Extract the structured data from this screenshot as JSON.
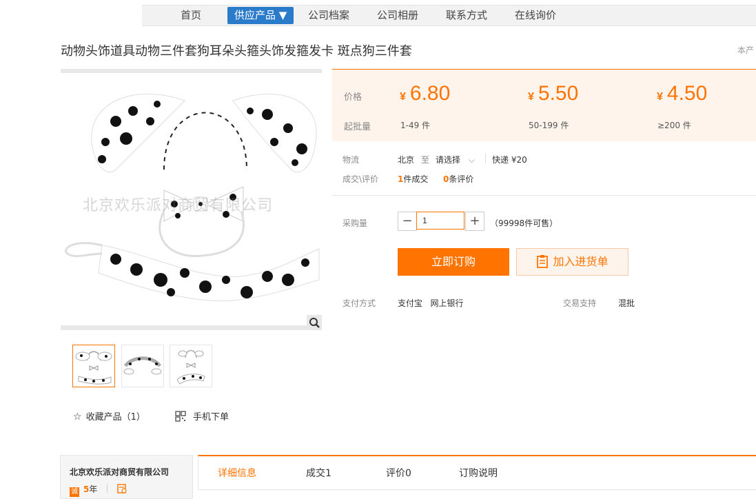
{
  "nav": {
    "items": [
      "首页",
      "供应产品 ▼",
      "公司档案",
      "公司相册",
      "联系方式",
      "在线询价"
    ]
  },
  "product": {
    "title": "动物头饰道具动物三件套狗耳朵头箍头饰发箍发卡 斑点狗三件套",
    "top_right_note": "本产"
  },
  "image": {
    "watermark": "北京欢乐派对商贸有限公司"
  },
  "price_box": {
    "price_label": "价格",
    "moq_label": "起批量",
    "currency": "¥",
    "tiers": [
      {
        "price": "6.80",
        "range": "1-49 件"
      },
      {
        "price": "5.50",
        "range": "50-199 件"
      },
      {
        "price": "4.50",
        "range": "≥200 件"
      }
    ]
  },
  "logistics": {
    "label": "物流",
    "from": "北京",
    "to_word": "至",
    "select": "请选择",
    "express": "快递 ¥20"
  },
  "deals": {
    "label": "成交\\评价",
    "deal_count": "1",
    "deal_text": "件成交",
    "review_count": "0",
    "review_text": "条评价"
  },
  "purchase": {
    "label": "采购量",
    "minus": "−",
    "plus": "+",
    "qty": "1",
    "available": "（99998件可售）"
  },
  "buttons": {
    "buy": "立即订购",
    "cart": "加入进货单"
  },
  "payment": {
    "label": "支付方式",
    "methods": "支付宝   网上银行",
    "trade_label": "交易支持",
    "trade_value": "混批"
  },
  "actions": {
    "favorite": "收藏产品（1）",
    "mobile": "手机下单"
  },
  "company": {
    "name": "北京欢乐派对商贸有限公司",
    "years": "5",
    "years_unit": "年",
    "badge": "诚"
  },
  "tabs": [
    "详细信息",
    "成交1",
    "评价0",
    "订购说明"
  ],
  "colors": {
    "accent": "#ff7300",
    "nav_active": "#2b7bcb",
    "price_bg": "#fff4ec"
  }
}
